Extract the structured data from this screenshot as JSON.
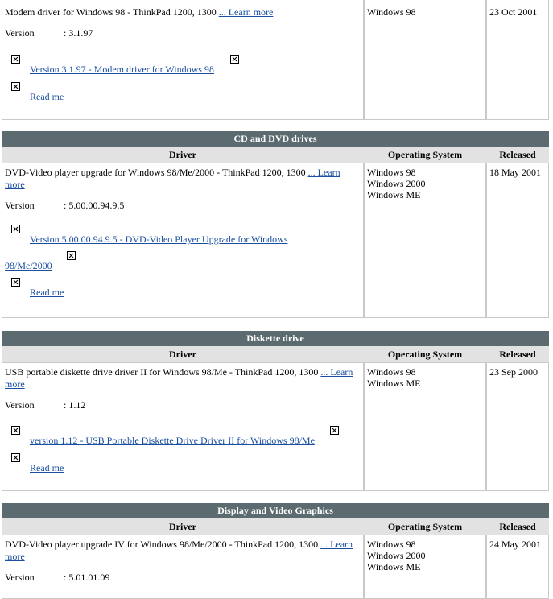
{
  "columns": {
    "driver": "Driver",
    "os": "Operating System",
    "released": "Released"
  },
  "section0": {
    "desc": "Modem driver for Windows 98 - ThinkPad 1200, 1300",
    "learn": "... Learn more",
    "version_label": "Version",
    "version_value": ": 3.1.97",
    "download": "Version 3.1.97 - Modem driver for Windows 98",
    "readme": "Read me",
    "os": [
      "Windows 98"
    ],
    "released": "23 Oct 2001"
  },
  "section1": {
    "title": "CD and DVD drives",
    "desc": "DVD-Video player upgrade for Windows 98/Me/2000 - ThinkPad 1200, 1300",
    "learn_a": "... Learn",
    "learn_b": "more",
    "version_label": "Version",
    "version_value": ": 5.00.00.94.9.5",
    "download_a": "Version 5.00.00.94.9.5 - DVD-Video Player Upgrade for Windows",
    "download_b": "98/Me/2000",
    "readme": "Read me",
    "os": [
      "Windows 98",
      "Windows 2000",
      "Windows ME"
    ],
    "released": "18 May 2001"
  },
  "section2": {
    "title": "Diskette drive",
    "desc": "USB portable diskette drive driver II for Windows 98/Me - ThinkPad 1200, 1300",
    "learn_a": "... Learn",
    "learn_b": "more",
    "version_label": "Version",
    "version_value": ": 1.12",
    "download": "version 1.12 - USB Portable Diskette Drive Driver II for Windows 98/Me",
    "readme": "Read me",
    "os": [
      "Windows 98",
      "Windows ME"
    ],
    "released": "23 Sep 2000"
  },
  "section3": {
    "title": "Display and Video Graphics",
    "desc": "DVD-Video player upgrade IV for Windows 98/Me/2000 - ThinkPad 1200, 1300",
    "learn_a": "... Learn",
    "learn_b": "more",
    "version_label": "Version",
    "version_value": ": 5.01.01.09",
    "os": [
      "Windows 98",
      "Windows 2000",
      "Windows ME"
    ],
    "released": "24 May 2001"
  }
}
